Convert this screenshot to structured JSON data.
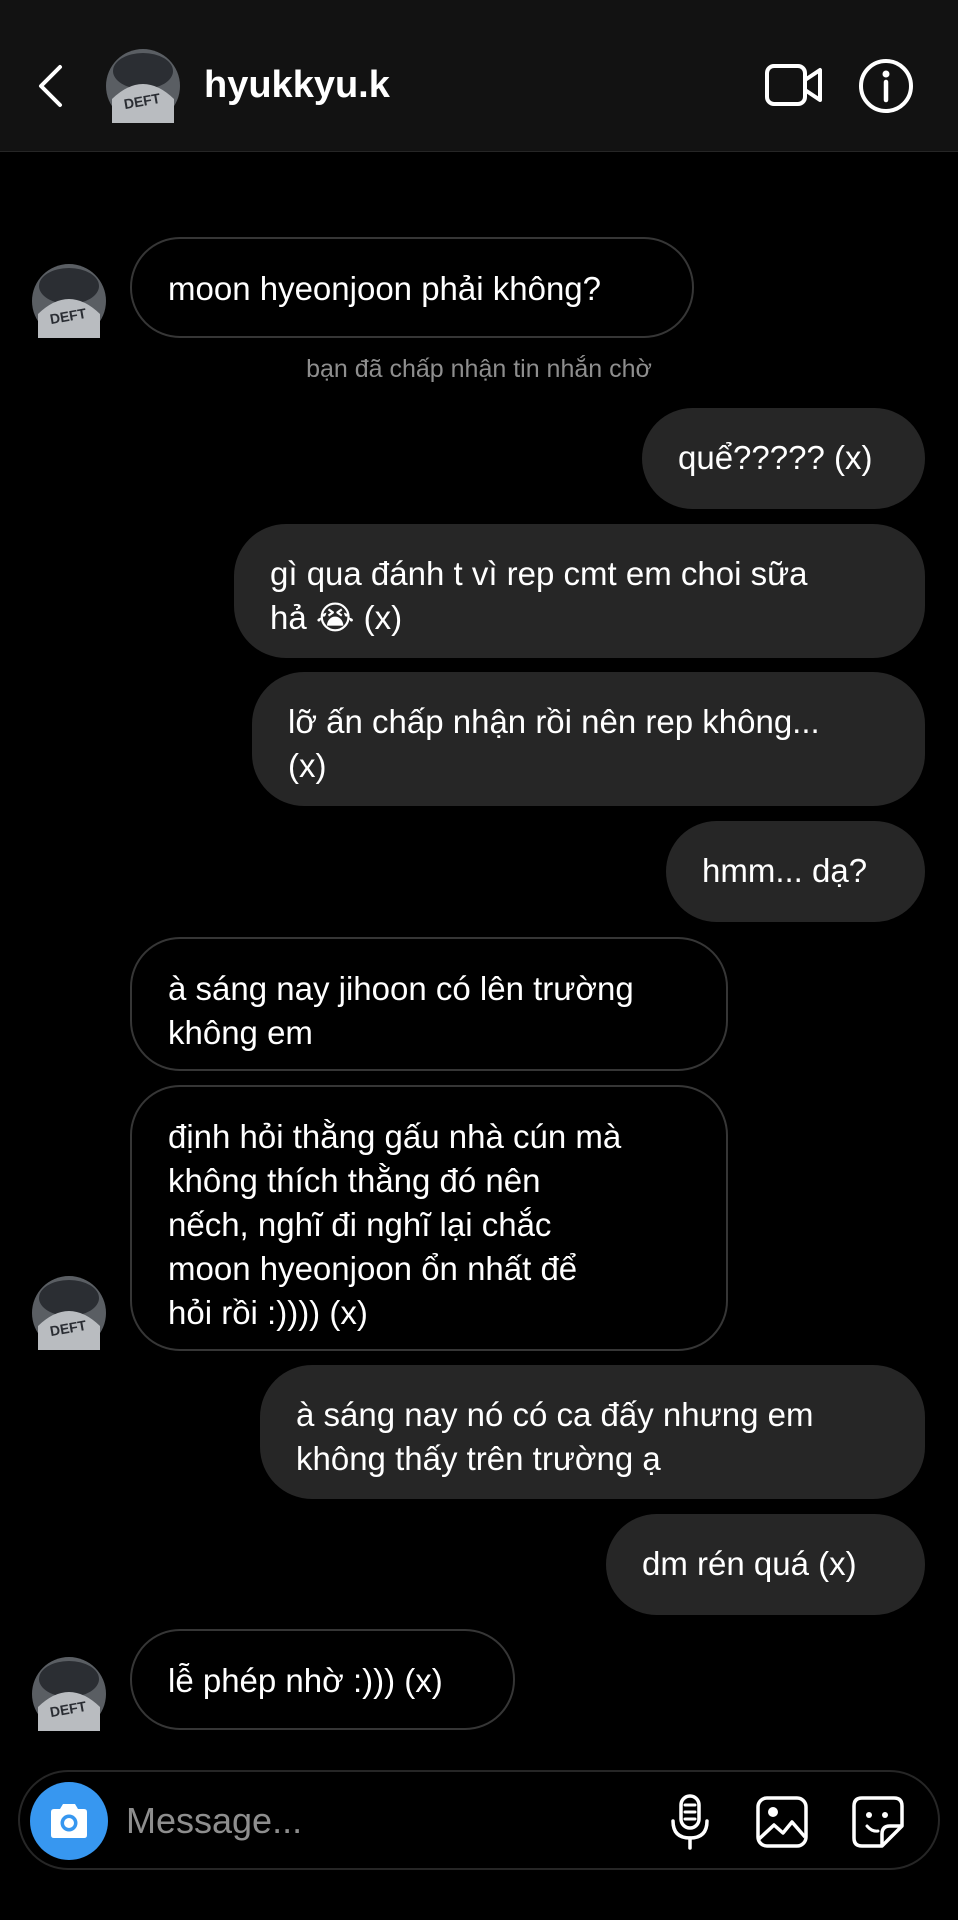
{
  "header": {
    "username": "hyukkyu.k",
    "avatar_text": "DEFT",
    "back_icon": "chevron-left-icon",
    "video_icon": "video-camera-icon",
    "info_icon": "info-icon"
  },
  "system_note": "bạn đã chấp nhận tin nhắn chờ",
  "messages": [
    {
      "direction": "incoming",
      "text": "moon hyeonjoon phải không?"
    },
    {
      "direction": "outgoing",
      "text": "quể????? (x)"
    },
    {
      "direction": "outgoing",
      "text": "gì qua đánh t vì rep cmt em choi sữa\nhả 😭 (x)"
    },
    {
      "direction": "outgoing",
      "text": "lỡ ấn chấp nhận rồi nên rep không...\n(x)"
    },
    {
      "direction": "outgoing",
      "text": "hmm... dạ?"
    },
    {
      "direction": "incoming",
      "text": "à sáng nay jihoon có lên trường\nkhông em"
    },
    {
      "direction": "incoming",
      "text": "định hỏi thằng gấu nhà cún mà\nkhông thích thằng đó nên\nnếch, nghĩ đi nghĩ lại chắc\nmoon hyeonjoon ổn nhất để\nhỏi rồi :)))) (x)"
    },
    {
      "direction": "outgoing",
      "text": "à sáng nay nó có ca đấy nhưng em\nkhông thấy trên trường ạ"
    },
    {
      "direction": "outgoing",
      "text": "dm rén quá (x)"
    },
    {
      "direction": "incoming",
      "text": "lễ phép nhờ :))) (x)"
    }
  ],
  "composer": {
    "placeholder": "Message...",
    "icons": [
      "camera-icon",
      "microphone-icon",
      "image-icon",
      "sticker-icon"
    ]
  },
  "colors": {
    "background": "#000000",
    "header": "#121212",
    "outgoing_bubble": "#262626",
    "incoming_border": "#363636",
    "accent": "#3797f0",
    "muted_text": "#8e8e8e"
  }
}
